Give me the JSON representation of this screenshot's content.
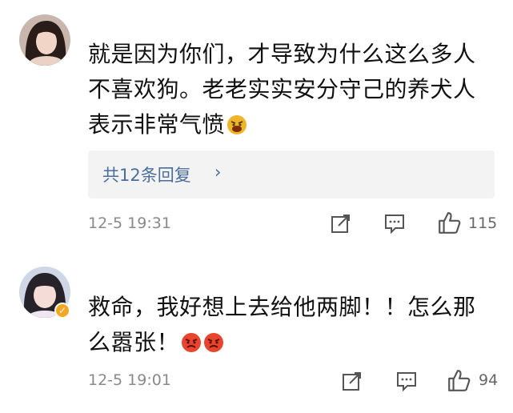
{
  "comments": [
    {
      "text_lines": [
        "就是因为你们，才导致为什么这么多人",
        "不喜欢狗。老老实实安分守己的养犬人",
        "表示非常气愤"
      ],
      "emoji_icons": [
        "angry-face-icon"
      ],
      "replies": "共12条回复",
      "timestamp": "12-5 19:31",
      "likes": "115",
      "verified": false
    },
    {
      "text_lines": [
        "救命，我好想上去给他两脚！！怎么那",
        "么嚣张！"
      ],
      "emoji_icons": [
        "angry-face-icon",
        "angry-face-icon"
      ],
      "timestamp": "12-5 19:01",
      "likes": "94",
      "verified": true
    }
  ],
  "icons": {
    "share": "share-icon",
    "comment": "comment-icon",
    "like": "thumbs-up-icon",
    "chevron": "›"
  },
  "colors": {
    "reply_link": "#4a6e9c",
    "meta_text": "#8a8a8a",
    "reply_bg": "#f3f3f3",
    "badge": "#f5a623"
  }
}
